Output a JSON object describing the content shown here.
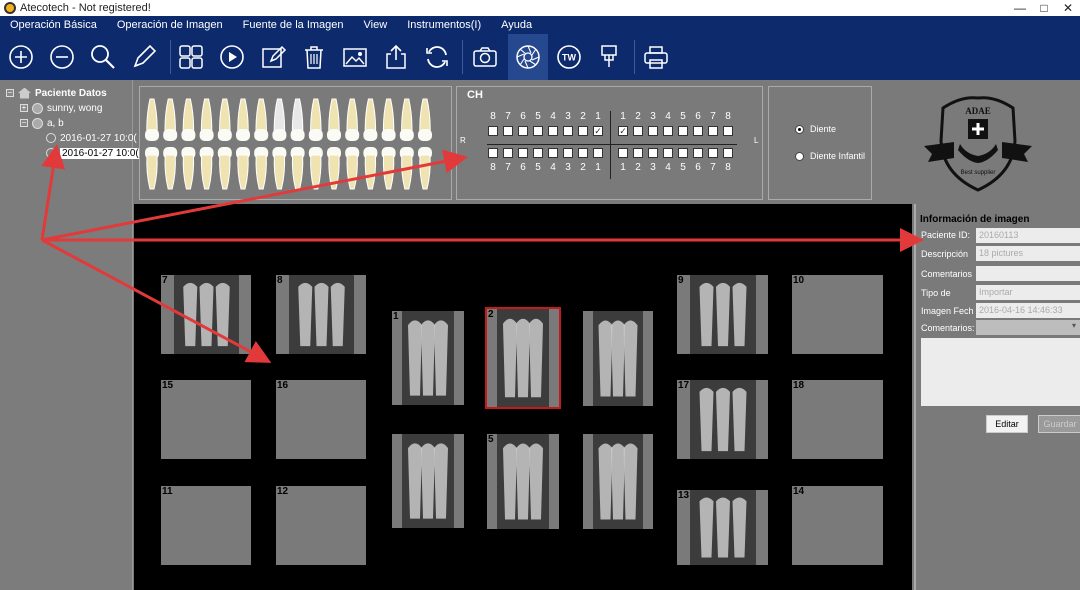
{
  "window": {
    "title": "Atecotech - Not registered!",
    "minimize": "—",
    "maximize": "□",
    "close": "✕"
  },
  "menu": [
    "Operación Básica",
    "Operación de Imagen",
    "Fuente de la Imagen",
    "View",
    "Instrumentos(I)",
    "Ayuda"
  ],
  "toolbar_icons": [
    "zoom-in-icon",
    "zoom-out-icon",
    "search-icon",
    "pencil-icon",
    "grid-layout-icon",
    "play-icon",
    "edit-icon",
    "trash-icon",
    "image-icon",
    "export-icon",
    "refresh-icon",
    "camera-icon",
    "aperture-icon",
    "tw-icon",
    "sensor-icon",
    "printer-icon"
  ],
  "toolbar_tw_label": "TW",
  "tree": {
    "root": "Paciente Datos",
    "patients": [
      "sunny, wong",
      "a, b"
    ],
    "dates": [
      "2016-01-27 10:0(",
      "2016-01-27 10:0("
    ]
  },
  "chart": {
    "title": "CH",
    "upper_left": [
      "8",
      "7",
      "6",
      "5",
      "4",
      "3",
      "2",
      "1"
    ],
    "upper_right": [
      "1",
      "2",
      "3",
      "4",
      "5",
      "6",
      "7",
      "8"
    ],
    "lower_left": [
      "8",
      "7",
      "6",
      "5",
      "4",
      "3",
      "2",
      "1"
    ],
    "lower_right": [
      "1",
      "2",
      "3",
      "4",
      "5",
      "6",
      "7",
      "8"
    ],
    "side_right": "R",
    "side_left": "L",
    "check_mark": "✓",
    "checked_upper_left_index": 7,
    "checked_upper_right_index": 0
  },
  "tooth_type": {
    "options": [
      "Diente",
      "Diente Infantil"
    ],
    "selected": 0
  },
  "logo": {
    "text_top": "ADAE",
    "text_bottom": "Best supplier"
  },
  "slots": [
    {
      "label": "7",
      "image": "xray"
    },
    {
      "label": "8",
      "image": "xray"
    },
    {
      "label": "1",
      "image": "xray"
    },
    {
      "label": "2",
      "image": "xray"
    },
    {
      "label": "",
      "image": "xray"
    },
    {
      "label": "9",
      "image": "xray"
    },
    {
      "label": "10",
      "image": ""
    },
    {
      "label": "15",
      "image": ""
    },
    {
      "label": "16",
      "image": ""
    },
    {
      "label": "17",
      "image": "xray"
    },
    {
      "label": "18",
      "image": ""
    },
    {
      "label": "",
      "image": "xray"
    },
    {
      "label": "5",
      "image": "xray"
    },
    {
      "label": "",
      "image": "xray"
    },
    {
      "label": "11",
      "image": ""
    },
    {
      "label": "12",
      "image": ""
    },
    {
      "label": "13",
      "image": "xray"
    },
    {
      "label": "14",
      "image": ""
    }
  ],
  "info": {
    "title": "Información de imagen",
    "patient_id_label": "Paciente ID:",
    "patient_id": "20160113",
    "description_label": "Descripción",
    "description": "18 pictures",
    "comments_label": "Comentarios",
    "comments": "",
    "type_label": "Tipo de",
    "type": "Importar",
    "date_label": "Imagen Fech",
    "date": "2016-04-16 14:46:33",
    "comments2_label": "Comentarios:",
    "comments2": "",
    "edit_label": "Editar",
    "save_label": "Guardar"
  },
  "colors": {
    "menubar": "#0d2a6d",
    "selected_outline": "#c41a1a",
    "arrow": "#e23a3a"
  }
}
